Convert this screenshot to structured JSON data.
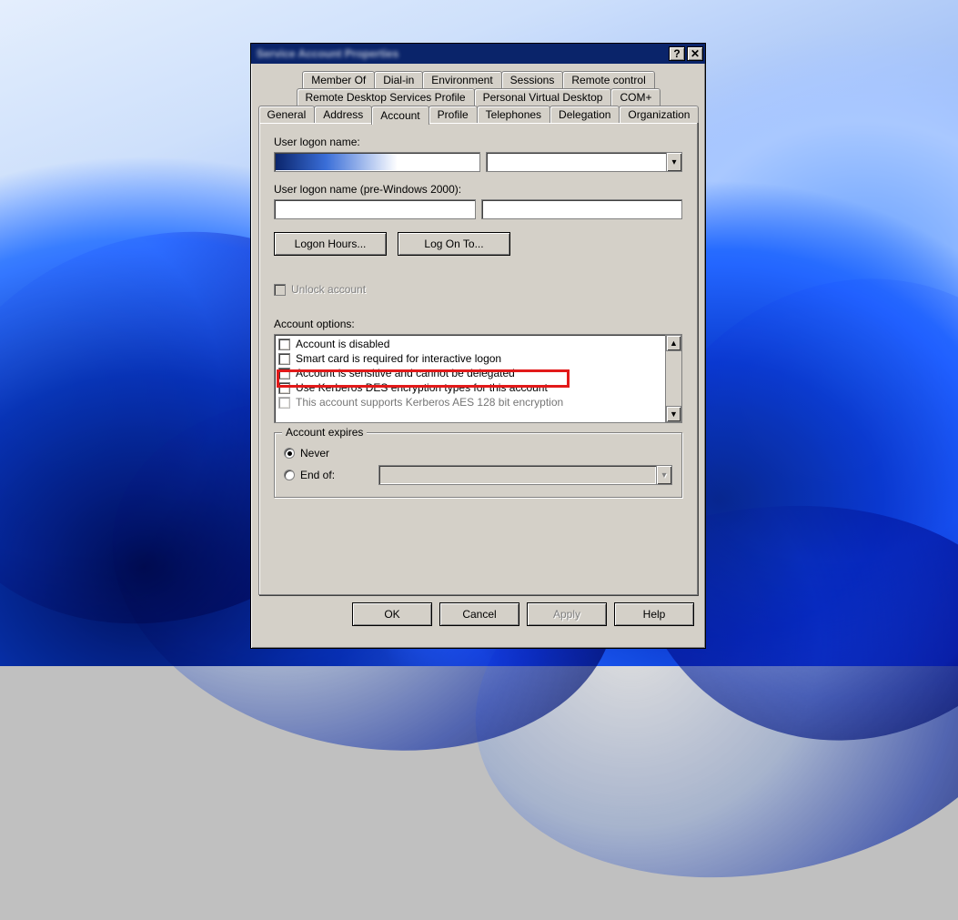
{
  "window": {
    "title": "Service Account Properties"
  },
  "tabs": {
    "row1": [
      "Member Of",
      "Dial-in",
      "Environment",
      "Sessions",
      "Remote control"
    ],
    "row2": [
      "Remote Desktop Services Profile",
      "Personal Virtual Desktop",
      "COM+"
    ],
    "row3": [
      "General",
      "Address",
      "Account",
      "Profile",
      "Telephones",
      "Delegation",
      "Organization"
    ],
    "active": "Account"
  },
  "account": {
    "logon_name_label": "User logon name:",
    "logon_name_value": "",
    "logon_domain_value": "",
    "prew2k_label": "User logon name (pre-Windows 2000):",
    "prew2k_domain": "",
    "prew2k_name": "",
    "logon_hours_btn": "Logon Hours...",
    "logonto_btn": "Log On To...",
    "unlock_label": "Unlock account",
    "options_label": "Account options:",
    "options": [
      "Account is disabled",
      "Smart card is required for interactive logon",
      "Account is sensitive and cannot be delegated",
      "Use Kerberos DES encryption types for this account",
      "This account supports Kerberos AES 128 bit encryption"
    ],
    "expires_legend": "Account expires",
    "expires_never": "Never",
    "expires_endof": "End of:",
    "expires_date": ""
  },
  "actions": {
    "ok": "OK",
    "cancel": "Cancel",
    "apply": "Apply",
    "help": "Help"
  }
}
